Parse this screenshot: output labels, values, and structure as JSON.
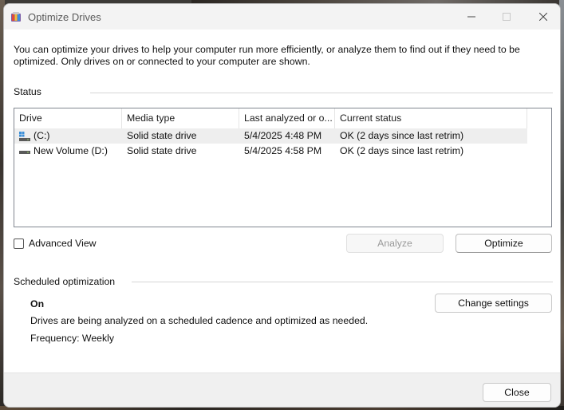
{
  "window": {
    "title": "Optimize Drives",
    "description": "You can optimize your drives to help your computer run more efficiently, or analyze them to find out if they need to be optimized. Only drives on or connected to your computer are shown."
  },
  "status": {
    "label": "Status",
    "columns": [
      "Drive",
      "Media type",
      "Last analyzed or o...",
      "Current status"
    ],
    "drives": [
      {
        "drive": "(C:)",
        "media_type": "Solid state drive",
        "last_analyzed": "5/4/2025 4:48 PM",
        "current_status": "OK (2 days since last retrim)",
        "icon": "windows-drive-icon",
        "selected": true
      },
      {
        "drive": "New Volume (D:)",
        "media_type": "Solid state drive",
        "last_analyzed": "5/4/2025 4:58 PM",
        "current_status": "OK (2 days since last retrim)",
        "icon": "drive-icon",
        "selected": false
      }
    ]
  },
  "advanced_view": {
    "label": "Advanced View",
    "checked": false
  },
  "buttons": {
    "analyze": "Analyze",
    "optimize": "Optimize",
    "change_settings": "Change settings",
    "close": "Close"
  },
  "scheduled": {
    "label": "Scheduled optimization",
    "state": "On",
    "description": "Drives are being analyzed on a scheduled cadence and optimized as needed.",
    "frequency": "Frequency: Weekly"
  },
  "colors": {
    "window_bg": "#ffffff",
    "titlebar_bg": "#f3f3f3",
    "footer_bg": "#f0f0f0",
    "selected_row": "#eeeeee"
  }
}
